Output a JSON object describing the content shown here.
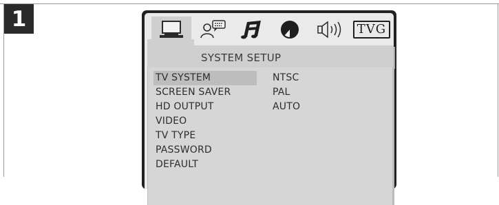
{
  "step": {
    "number": "1"
  },
  "icons": [
    {
      "name": "monitor-icon",
      "active": true
    },
    {
      "name": "language-icon",
      "active": false
    },
    {
      "name": "audio-note-icon",
      "active": false
    },
    {
      "name": "video-adjust-icon",
      "active": false
    },
    {
      "name": "speaker-icon",
      "active": false
    },
    {
      "name": "tvg-icon",
      "label": "TVG",
      "active": false
    }
  ],
  "section": {
    "title": "SYSTEM SETUP"
  },
  "menu": {
    "items": [
      {
        "label": "TV SYSTEM",
        "selected": true
      },
      {
        "label": "SCREEN SAVER",
        "selected": false
      },
      {
        "label": "HD OUTPUT",
        "selected": false
      },
      {
        "label": "VIDEO",
        "selected": false
      },
      {
        "label": "TV TYPE",
        "selected": false
      },
      {
        "label": "PASSWORD",
        "selected": false
      },
      {
        "label": "DEFAULT",
        "selected": false
      }
    ]
  },
  "options": {
    "items": [
      {
        "label": "NTSC"
      },
      {
        "label": "PAL"
      },
      {
        "label": "AUTO"
      }
    ]
  },
  "colors": {
    "osd_border": "#222222",
    "osd_background": "#eaeaea",
    "highlight": "#cfcfcf",
    "selected_row": "#bdbdbd",
    "text": "#2d2d2d"
  }
}
